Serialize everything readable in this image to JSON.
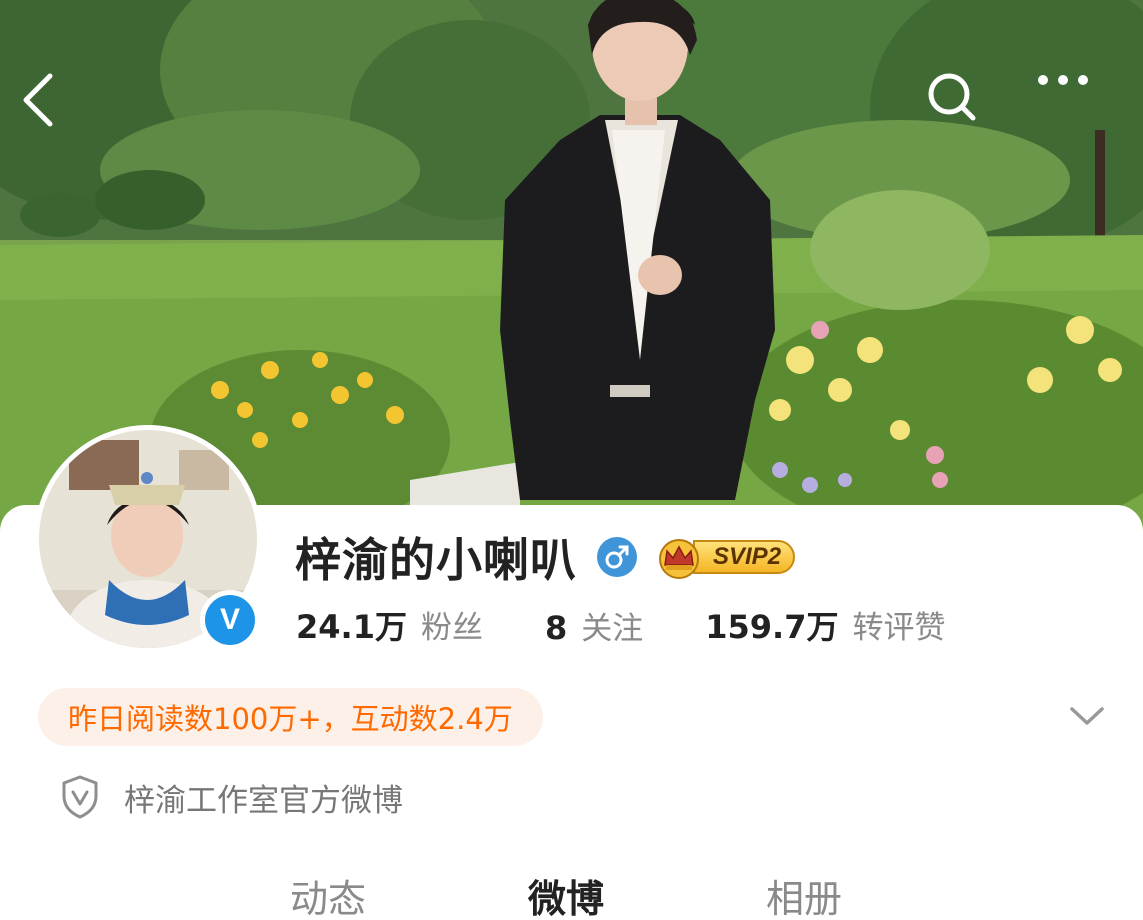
{
  "profile": {
    "name": "梓渝的小喇叭",
    "gender_symbol": "♂",
    "vip_badge": "SVIP2",
    "verified_mark": "V"
  },
  "stats": [
    {
      "value": "24.1万",
      "label": "粉丝"
    },
    {
      "value": "8",
      "label": "关注"
    },
    {
      "value": "159.7万",
      "label": "转评赞"
    }
  ],
  "highlight": {
    "text": "昨日阅读数100万+，互动数2.4万"
  },
  "certification": {
    "text": "梓渝工作室官方微博"
  },
  "tabs": [
    {
      "label": "动态",
      "active": false
    },
    {
      "label": "微博",
      "active": true
    },
    {
      "label": "相册",
      "active": false
    }
  ],
  "icons": {
    "back": "back-arrow-icon",
    "search": "search-icon",
    "more": "more-dots-icon",
    "expand": "chevron-down-icon",
    "shield": "shield-icon"
  },
  "colors": {
    "accent_orange": "#ff6a00",
    "pill_background": "#fdf0e8",
    "verified_blue": "#1d94e8",
    "gender_blue": "#3f95d8",
    "vip_gold": "#f5b624"
  }
}
